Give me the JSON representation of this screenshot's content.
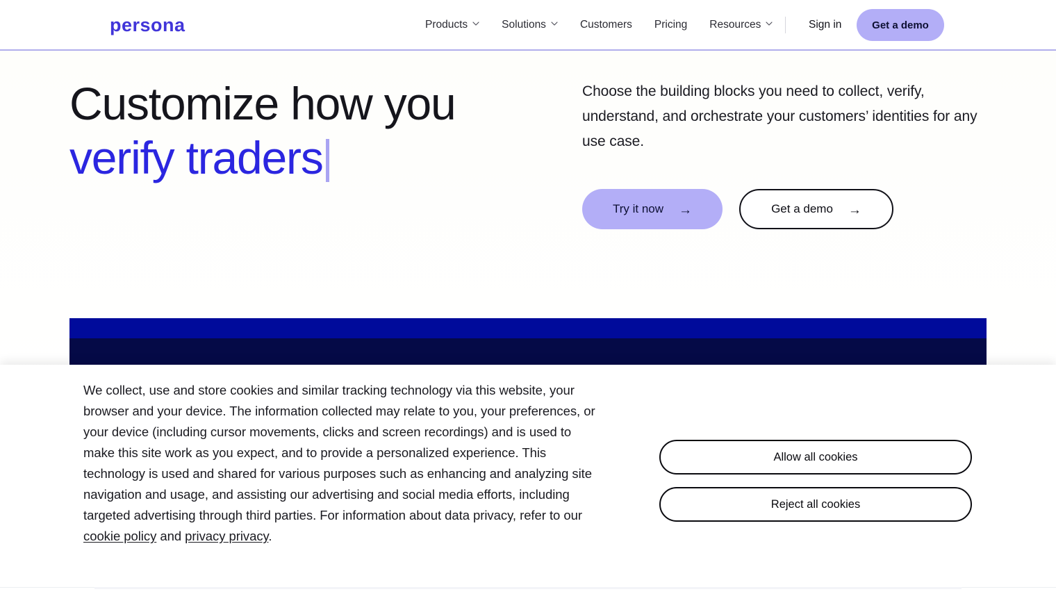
{
  "header": {
    "logo_text": "persona",
    "nav_items": [
      {
        "label": "Products",
        "icon": "chevron-down-icon",
        "has_dropdown": true
      },
      {
        "label": "Solutions",
        "icon": "chevron-down-icon",
        "has_dropdown": true
      },
      {
        "label": "Customers",
        "has_dropdown": false
      },
      {
        "label": "Pricing",
        "has_dropdown": false
      },
      {
        "label": "Resources",
        "icon": "chevron-down-icon",
        "has_dropdown": true
      }
    ],
    "sign_in_label": "Sign in",
    "cta_label": "Get a demo",
    "border_color": "#b0aeec",
    "logo_color": "#4135d9",
    "cta_bg": "#b3aef7"
  },
  "hero": {
    "heading_line1": "Customize how you",
    "heading_line2": "verify traders",
    "heading_line2_color": "#2b26e0",
    "caret_color": "#a9a4f2",
    "subheading": "Choose the building blocks you need to collect, verify, understand, and orchestrate your customers’ identities for any use case.",
    "primary_button": {
      "label": "Try it now",
      "arrow": "→",
      "bg": "#b3aef7"
    },
    "secondary_button": {
      "label": "Get a demo",
      "arrow": "→",
      "bg": "#ffffff"
    }
  },
  "media_panel": {
    "band_top_color": "#000b9b",
    "band_bottom_color": "#050a47"
  },
  "cookie_banner": {
    "body_part1": "We collect, use and store cookies and similar tracking technology via this website, your browser and your device. The information collected may relate to you, your preferences, or your device (including cursor movements, clicks and screen recordings) and is used to make this site work as you expect, and to provide a personalized experience. This technology is used and shared for various purposes such as enhancing and analyzing site navigation and usage, and assisting our advertising and social media efforts, including targeted advertising through third parties. For information about data privacy, refer to our ",
    "link_cookie_policy": "cookie policy",
    "body_connector": " and ",
    "link_privacy": "privacy privacy",
    "body_end": ".",
    "allow_button_label": "Allow all cookies",
    "reject_button_label": "Reject all cookies"
  }
}
